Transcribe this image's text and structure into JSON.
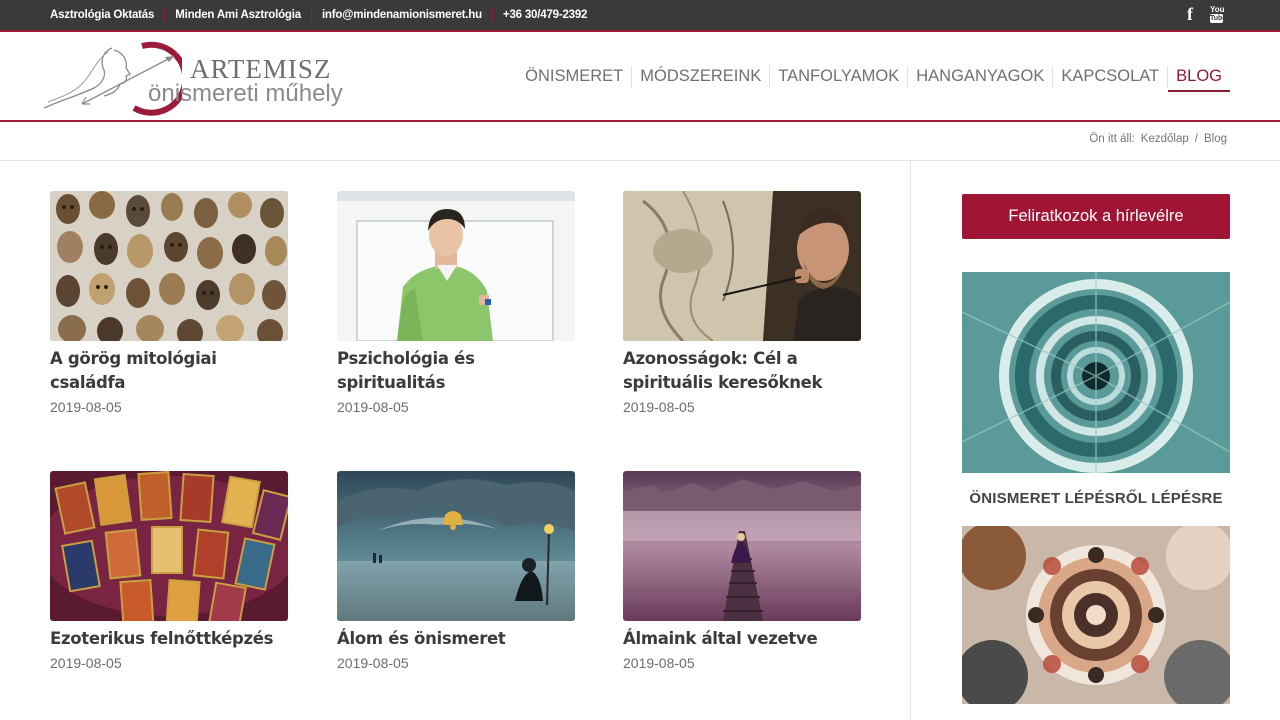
{
  "topbar": {
    "links": [
      "Asztrológia Oktatás",
      "Minden Ami Asztrológia",
      "info@mindenamionismeret.hu",
      "+36 30/479-2392"
    ],
    "social": {
      "facebook": "f",
      "youtube_top": "You",
      "youtube_bottom": "Tube"
    }
  },
  "header": {
    "brand_top": "ARTEMISZ",
    "brand_bottom": "önismereti műhely",
    "nav": [
      "ÖNISMERET",
      "MÓDSZEREINK",
      "TANFOLYAMOK",
      "HANGANYAGOK",
      "KAPCSOLAT",
      "BLOG"
    ],
    "active_nav": "BLOG"
  },
  "breadcrumb": {
    "prefix": "Ön itt áll:",
    "home": "Kezdőlap",
    "separator": "/",
    "current": "Blog"
  },
  "posts": [
    {
      "title": "A görög mitológiai családfa",
      "date": "2019-08-05"
    },
    {
      "title": "Pszichológia és spiritualitás",
      "date": "2019-08-05"
    },
    {
      "title": "Azonosságok: Cél a spirituális keresőknek",
      "date": "2019-08-05"
    },
    {
      "title": "Ezoterikus felnőttképzés",
      "date": "2019-08-05"
    },
    {
      "title": "Álom és önismeret",
      "date": "2019-08-05"
    },
    {
      "title": "Álmaink által vezetve",
      "date": "2019-08-05"
    }
  ],
  "sidebar": {
    "subscribe_label": "Feliratkozok a hírlevélre",
    "widget_title": "ÖNISMERET LÉPÉSRŐL LÉPÉSRE"
  },
  "colors": {
    "accent": "#9b1b3a",
    "topbar": "#3a3a3a",
    "button": "#a01535"
  }
}
